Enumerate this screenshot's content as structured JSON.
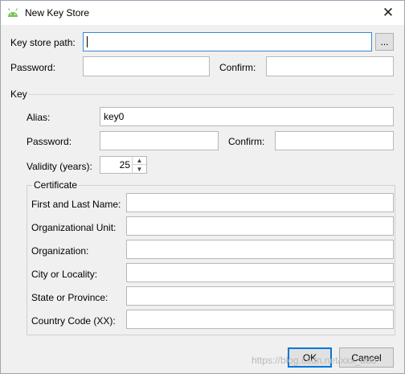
{
  "window": {
    "title": "New Key Store",
    "close_glyph": "✕",
    "app_icon": "android-icon"
  },
  "keystore": {
    "path_label": "Key store path:",
    "path_value": "",
    "browse_label": "...",
    "password_label": "Password:",
    "confirm_label": "Confirm:"
  },
  "key": {
    "section_label": "Key",
    "alias_label": "Alias:",
    "alias_value": "key0",
    "password_label": "Password:",
    "confirm_label": "Confirm:",
    "validity_label": "Validity (years):",
    "validity_value": "25",
    "spin_up": "▲",
    "spin_down": "▼"
  },
  "certificate": {
    "group_label": "Certificate",
    "fields": [
      {
        "label": "First and Last Name:",
        "value": ""
      },
      {
        "label": "Organizational Unit:",
        "value": ""
      },
      {
        "label": "Organization:",
        "value": ""
      },
      {
        "label": "City or Locality:",
        "value": ""
      },
      {
        "label": "State or Province:",
        "value": ""
      },
      {
        "label": "Country Code (XX):",
        "value": ""
      }
    ]
  },
  "buttons": {
    "ok_label": "OK",
    "cancel_label": "Cancel"
  },
  "watermark": "https://blog.csdn.net/xxx_bbb",
  "colors": {
    "focus_border": "#3a86d4",
    "default_button_border": "#0078d7",
    "android_green": "#78c257"
  }
}
